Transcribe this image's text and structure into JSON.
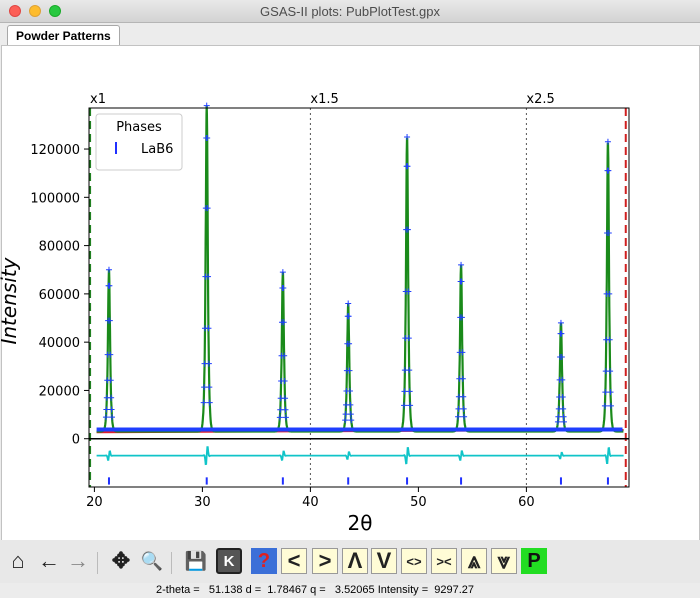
{
  "window": {
    "title": "GSAS-II plots: PubPlotTest.gpx"
  },
  "tabs": [
    {
      "label": "Powder Patterns"
    }
  ],
  "chart_data": {
    "type": "line",
    "xlabel": "2θ",
    "ylabel": "Intensity",
    "xlim": [
      19.5,
      69.5
    ],
    "ylim": [
      -20000,
      137000
    ],
    "xticks": [
      "20",
      "30",
      "40",
      "50",
      "60"
    ],
    "yticks": [
      "0",
      "20000",
      "40000",
      "60000",
      "80000",
      "100000",
      "120000"
    ],
    "scale_regions": [
      {
        "label": "x1",
        "start": 19.6
      },
      {
        "label": "x1.5",
        "start": 40.0
      },
      {
        "label": "x2.5",
        "start": 60.0
      }
    ],
    "excluded_limits": [
      19.6,
      69.2
    ],
    "legend": {
      "title": "Phases",
      "entries": [
        "LaB6"
      ],
      "placement": "top-left"
    },
    "background_level": 3000,
    "peaks": [
      {
        "x": 21.35,
        "height": 67000
      },
      {
        "x": 30.4,
        "height": 135000
      },
      {
        "x": 37.45,
        "height": 66000
      },
      {
        "x": 43.5,
        "height": 53000
      },
      {
        "x": 48.95,
        "height": 122000
      },
      {
        "x": 53.95,
        "height": 69000
      },
      {
        "x": 63.2,
        "height": 45000
      },
      {
        "x": 67.55,
        "height": 120000
      }
    ],
    "reflection_ticks": [
      21.35,
      30.4,
      37.45,
      43.5,
      48.95,
      53.95,
      63.2,
      67.55
    ],
    "difference_level": -7000,
    "colors": {
      "observed": "#1f3fff",
      "calculated": "#1a8a1a",
      "background": "#e0202a",
      "difference": "#10c4c8",
      "ticks": "#2030ff",
      "exclusion": "#d02020",
      "limit": "#208020"
    }
  },
  "toolbar": {
    "buttons": [
      {
        "name": "home-icon",
        "glyph": "⌂"
      },
      {
        "name": "back-arrow-icon",
        "glyph": "←"
      },
      {
        "name": "forward-arrow-icon",
        "glyph": "→"
      },
      {
        "name": "pan-icon",
        "glyph": "✥"
      },
      {
        "name": "zoom-icon",
        "glyph": "🔍"
      },
      {
        "name": "save-icon",
        "glyph": "💾"
      },
      {
        "name": "key-icon",
        "glyph": "K"
      },
      {
        "name": "help-icon",
        "glyph": "?"
      },
      {
        "name": "shift-left-icon",
        "glyph": "<"
      },
      {
        "name": "shift-right-icon",
        "glyph": ">"
      },
      {
        "name": "shift-up-icon",
        "glyph": "Λ"
      },
      {
        "name": "shift-down-icon",
        "glyph": "V"
      },
      {
        "name": "expand-x-icon",
        "glyph": "<>"
      },
      {
        "name": "shrink-x-icon",
        "glyph": "><"
      },
      {
        "name": "expand-y-icon",
        "glyph": "⩓"
      },
      {
        "name": "shrink-y-icon",
        "glyph": "⩔"
      },
      {
        "name": "publish-icon",
        "glyph": "P"
      }
    ]
  },
  "status": {
    "text": "2-theta =   51.138 d =  1.78467 q =   3.52065 Intensity =  9297.27"
  }
}
